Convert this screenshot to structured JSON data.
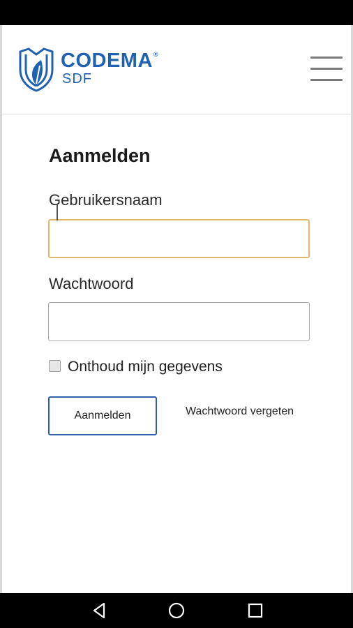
{
  "brand": {
    "name": "CODEMA",
    "trademark": "®",
    "subtitle": "SDF",
    "color": "#1f62b3"
  },
  "header": {
    "menu_icon": "hamburger-menu-icon"
  },
  "login": {
    "title": "Aanmelden",
    "username_label": "Gebruikersnaam",
    "username_value": "",
    "password_label": "Wachtwoord",
    "password_value": "",
    "remember_label": "Onthoud mijn gegevens",
    "remember_checked": false,
    "submit_label": "Aanmelden",
    "forgot_label": "Wachtwoord vergeten"
  },
  "colors": {
    "focus_border": "#e3b66a",
    "button_border": "#2f5fa8"
  },
  "navigation": {
    "back_icon": "back-triangle-icon",
    "home_icon": "home-circle-icon",
    "recents_icon": "recents-square-icon"
  }
}
